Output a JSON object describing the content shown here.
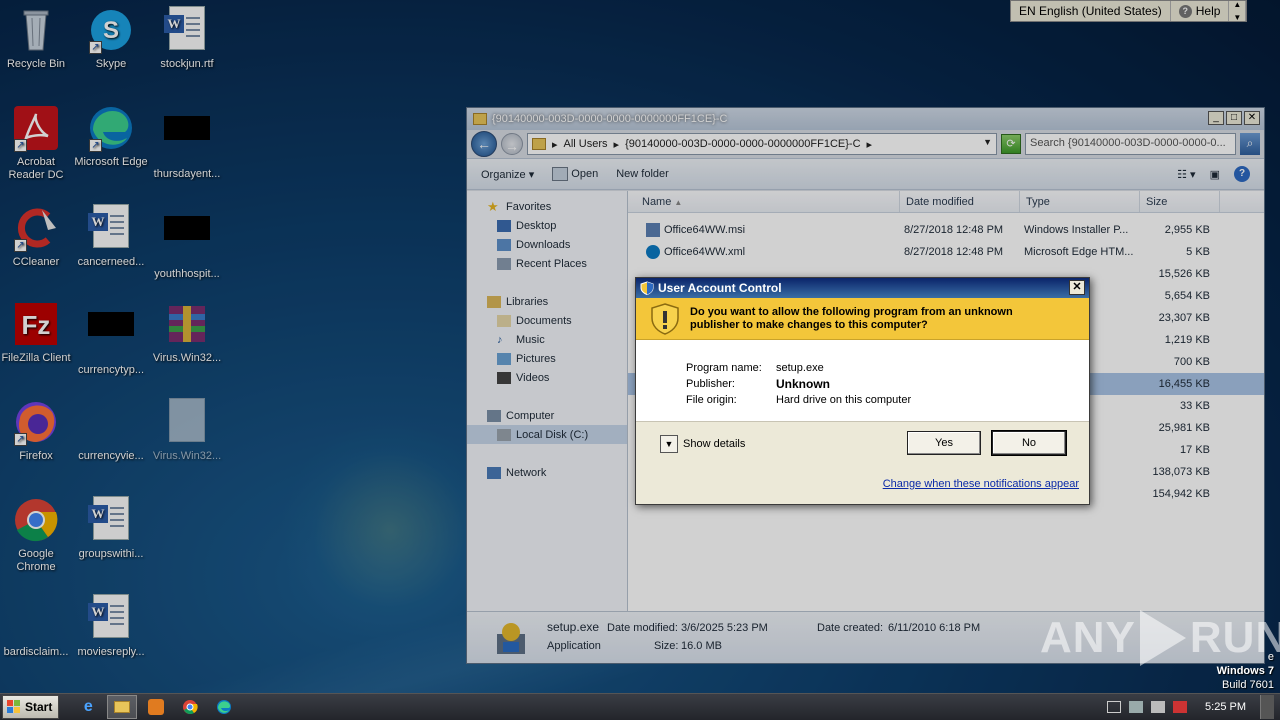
{
  "desktop": {
    "icons": [
      {
        "label": "Recycle Bin"
      },
      {
        "label": "Skype"
      },
      {
        "label": "stockjun.rtf"
      },
      {
        "label": "Acrobat Reader DC"
      },
      {
        "label": "Microsoft Edge"
      },
      {
        "label": "thursdayent..."
      },
      {
        "label": "CCleaner"
      },
      {
        "label": "cancerneed..."
      },
      {
        "label": "youthhospit..."
      },
      {
        "label": "FileZilla Client"
      },
      {
        "label": "currencytyp..."
      },
      {
        "label": "Virus.Win32..."
      },
      {
        "label": "Firefox"
      },
      {
        "label": "currencyvie..."
      },
      {
        "label": "Virus.Win32..."
      },
      {
        "label": "Google Chrome"
      },
      {
        "label": "groupswithi..."
      },
      {
        "label": "bardisclaim..."
      },
      {
        "label": "moviesreply..."
      }
    ]
  },
  "language_bar": {
    "language": "EN English (United States)",
    "help": "Help"
  },
  "explorer": {
    "title": "{90140000-003D-0000-0000-0000000FF1CE}-C",
    "address_parts": [
      "All Users",
      "{90140000-003D-0000-0000-0000000FF1CE}-C"
    ],
    "search_placeholder": "Search {90140000-003D-0000-0000-0...",
    "toolbar": {
      "organize": "Organize",
      "open": "Open",
      "new_folder": "New folder"
    },
    "nav": {
      "favorites": "Favorites",
      "desktop": "Desktop",
      "downloads": "Downloads",
      "recent_places": "Recent Places",
      "libraries": "Libraries",
      "documents": "Documents",
      "music": "Music",
      "pictures": "Pictures",
      "videos": "Videos",
      "computer": "Computer",
      "local_disk": "Local Disk (C:)",
      "network": "Network"
    },
    "columns": {
      "name": "Name",
      "date_modified": "Date modified",
      "type": "Type",
      "size": "Size"
    },
    "rows": [
      {
        "name": "Office64WW.msi",
        "date": "8/27/2018 12:48 PM",
        "type": "Windows Installer P...",
        "size": "2,955 KB"
      },
      {
        "name": "Office64WW.xml",
        "date": "8/27/2018 12:48 PM",
        "type": "Microsoft Edge HTM...",
        "size": "5 KB"
      },
      {
        "name": "",
        "date": "",
        "type": "",
        "size": "15,526 KB"
      },
      {
        "name": "",
        "date": "",
        "type": "tension",
        "size": "5,654 KB"
      },
      {
        "name": "",
        "date": "",
        "type": "ve",
        "size": "23,307 KB"
      },
      {
        "name": "",
        "date": "",
        "type": "tension",
        "size": "1,219 KB"
      },
      {
        "name": "",
        "date": "",
        "type": "cense",
        "size": "700 KB"
      },
      {
        "name": "",
        "date": "",
        "type": "",
        "size": "16,455 KB"
      },
      {
        "name": "",
        "date": "",
        "type": "e HTM...",
        "size": "33 KB"
      },
      {
        "name": "",
        "date": "",
        "type": "aller P...",
        "size": "25,981 KB"
      },
      {
        "name": "",
        "date": "",
        "type": "aller P...",
        "size": "17 KB"
      },
      {
        "name": "",
        "date": "",
        "type": "ve",
        "size": "138,073 KB"
      },
      {
        "name": "",
        "date": "",
        "type": "ve",
        "size": "154,942 KB"
      }
    ],
    "details": {
      "filename": "setup.exe",
      "modified_label": "Date modified:",
      "modified": "3/6/2025 5:23 PM",
      "created_label": "Date created:",
      "created": "6/11/2010 6:18 PM",
      "kind": "Application",
      "size_label": "Size:",
      "size": "16.0 MB"
    }
  },
  "uac": {
    "title": "User Account Control",
    "question_line1": "Do you want to allow the following program from an unknown",
    "question_line2": "publisher to make changes to this computer?",
    "program_name_label": "Program name:",
    "program_name": "setup.exe",
    "publisher_label": "Publisher:",
    "publisher": "Unknown",
    "file_origin_label": "File origin:",
    "file_origin": "Hard drive on this computer",
    "show_details": "Show details",
    "yes": "Yes",
    "no": "No",
    "change_link": "Change when these notifications appear"
  },
  "watermark": {
    "left": "ANY",
    "right": "RUN"
  },
  "windows_version": {
    "edition_partial": "e",
    "name": "Windows 7",
    "build": "Build 7601"
  },
  "taskbar": {
    "start": "Start",
    "clock": "5:25 PM"
  },
  "colors": {
    "uac_banner": "#f3c63a",
    "selected_row": "#a9c4e6",
    "link": "#0b2aa8"
  }
}
